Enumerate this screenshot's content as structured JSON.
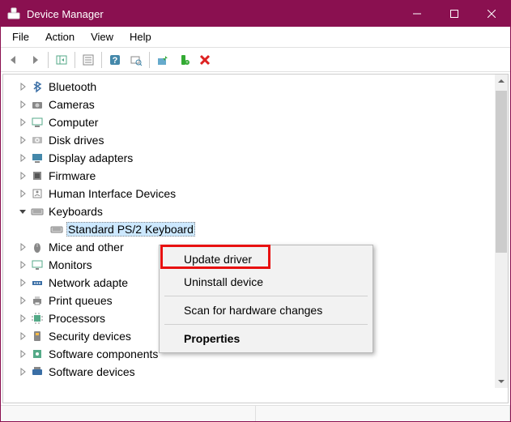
{
  "window": {
    "title": "Device Manager"
  },
  "menu": {
    "file": "File",
    "action": "Action",
    "view": "View",
    "help": "Help"
  },
  "tree": {
    "items": [
      {
        "label": "Bluetooth",
        "expanded": false
      },
      {
        "label": "Cameras",
        "expanded": false
      },
      {
        "label": "Computer",
        "expanded": false
      },
      {
        "label": "Disk drives",
        "expanded": false
      },
      {
        "label": "Display adapters",
        "expanded": false
      },
      {
        "label": "Firmware",
        "expanded": false
      },
      {
        "label": "Human Interface Devices",
        "expanded": false
      },
      {
        "label": "Keyboards",
        "expanded": true
      },
      {
        "label": "Standard PS/2 Keyboard",
        "child": true,
        "selected": true
      },
      {
        "label": "Mice and other",
        "expanded": false,
        "truncated": true
      },
      {
        "label": "Monitors",
        "expanded": false
      },
      {
        "label": "Network adapte",
        "expanded": false,
        "truncated": true
      },
      {
        "label": "Print queues",
        "expanded": false
      },
      {
        "label": "Processors",
        "expanded": false
      },
      {
        "label": "Security devices",
        "expanded": false
      },
      {
        "label": "Software components",
        "expanded": false
      },
      {
        "label": "Software devices",
        "expanded": false
      }
    ]
  },
  "context_menu": {
    "update_driver": "Update driver",
    "uninstall_device": "Uninstall device",
    "scan_hardware": "Scan for hardware changes",
    "properties": "Properties"
  },
  "colors": {
    "titlebar": "#8a1050",
    "highlight": "#e81010",
    "selection": "#cce8ff"
  }
}
